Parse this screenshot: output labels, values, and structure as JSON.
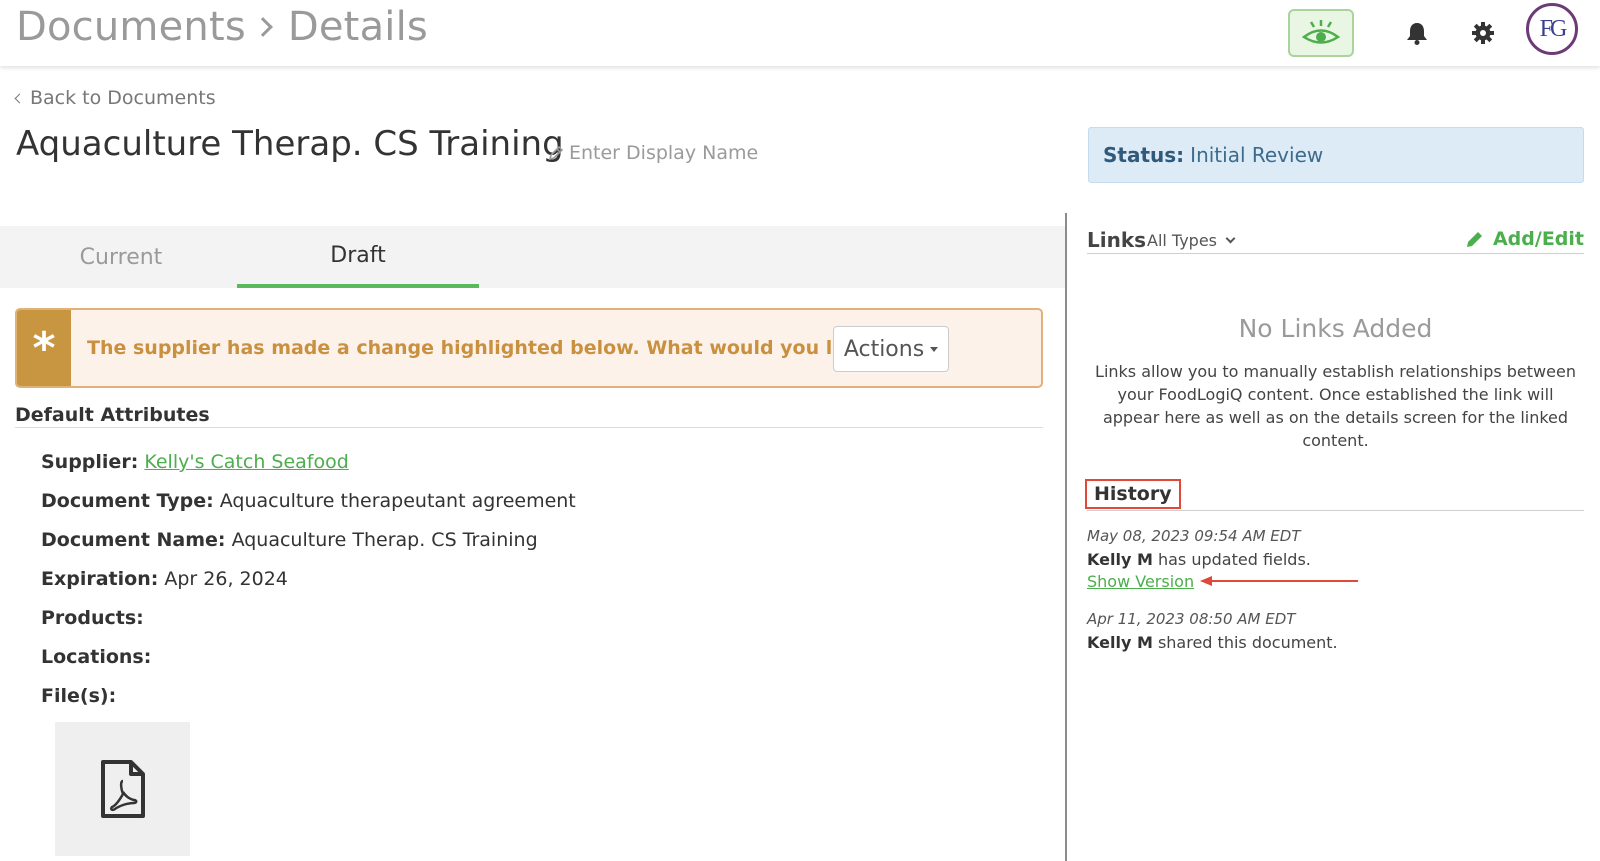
{
  "header": {
    "crumbs": [
      "Documents",
      "Details"
    ],
    "avatar_initials": "FG"
  },
  "page": {
    "back_label": "Back to Documents",
    "title": "Aquaculture Therap. CS Training",
    "display_name_placeholder": "Enter Display Name",
    "status_label": "Status:",
    "status_value": "Initial Review"
  },
  "tabs": [
    {
      "label": "Current",
      "active": false
    },
    {
      "label": "Draft",
      "active": true
    }
  ],
  "alert": {
    "symbol": "*",
    "message": "The supplier has made a change highlighted below. What would you like to do?",
    "actions_label": "Actions"
  },
  "attributes": {
    "section_title": "Default Attributes",
    "supplier_label": "Supplier:",
    "supplier_value": "Kelly's Catch Seafood",
    "doc_type_label": "Document Type:",
    "doc_type_value": "Aquaculture therapeutant agreement",
    "doc_name_label": "Document Name:",
    "doc_name_value": "Aquaculture Therap. CS Training",
    "expiration_label": "Expiration:",
    "expiration_value": "Apr 26, 2024",
    "products_label": "Products:",
    "locations_label": "Locations:",
    "files_label": "File(s):"
  },
  "links": {
    "title": "Links",
    "filter": "All Types",
    "add_edit_label": "Add/Edit",
    "empty_title": "No Links Added",
    "empty_desc": "Links allow you to manually establish relationships between your FoodLogiQ content. Once established the link will appear here as well as on the details screen for the linked content."
  },
  "history": {
    "title": "History",
    "entries": [
      {
        "date": "May 08, 2023 09:54 AM EDT",
        "user": "Kelly M",
        "action": "has updated fields.",
        "link": "Show Version"
      },
      {
        "date": "Apr 11, 2023 08:50 AM EDT",
        "user": "Kelly M",
        "action": "shared this document."
      }
    ]
  },
  "colors": {
    "accent_green": "#4cae4c",
    "alert_orange": "#c89640",
    "status_blue": "#dcebf6",
    "highlight_red": "#e0483a"
  }
}
